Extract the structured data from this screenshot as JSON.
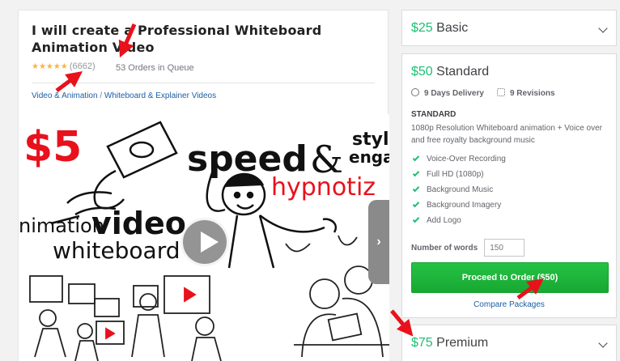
{
  "gig": {
    "title": "I will create a Professional Whiteboard Animation Video",
    "stars": "★★★★★",
    "review_count": "(6662)",
    "queue": "53 Orders in Queue",
    "breadcrumb": {
      "category": "Video & Animation",
      "separator": " / ",
      "subcategory": "Whiteboard & Explainer Videos"
    },
    "video": {
      "texts": {
        "price": "$5",
        "speed": "speed",
        "amp": "&",
        "style": "style",
        "engage": "engag",
        "hypnotize": "hypnotiz",
        "animation": "nimation",
        "video": "video",
        "whiteboard": "whiteboard"
      }
    }
  },
  "packages": {
    "basic": {
      "price": "$25",
      "name": "Basic"
    },
    "standard": {
      "price": "$50",
      "name": "Standard",
      "delivery": "9 Days Delivery",
      "revisions": "9 Revisions",
      "label": "STANDARD",
      "description": "1080p Resolution Whiteboard animation + Voice over and free royalty background music",
      "features": [
        "Voice-Over Recording",
        "Full HD (1080p)",
        "Background Music",
        "Background Imagery",
        "Add Logo"
      ],
      "words_label": "Number of words",
      "words_value": "150",
      "order_button": "Proceed to Order ($50)",
      "compare": "Compare Packages"
    },
    "premium": {
      "price": "$75",
      "name": "Premium"
    }
  },
  "colors": {
    "accent": "#1dbf73",
    "button": "#1dbf33",
    "link": "#1b5ea3",
    "star": "#ffb33e",
    "annotation": "#e8111c"
  }
}
